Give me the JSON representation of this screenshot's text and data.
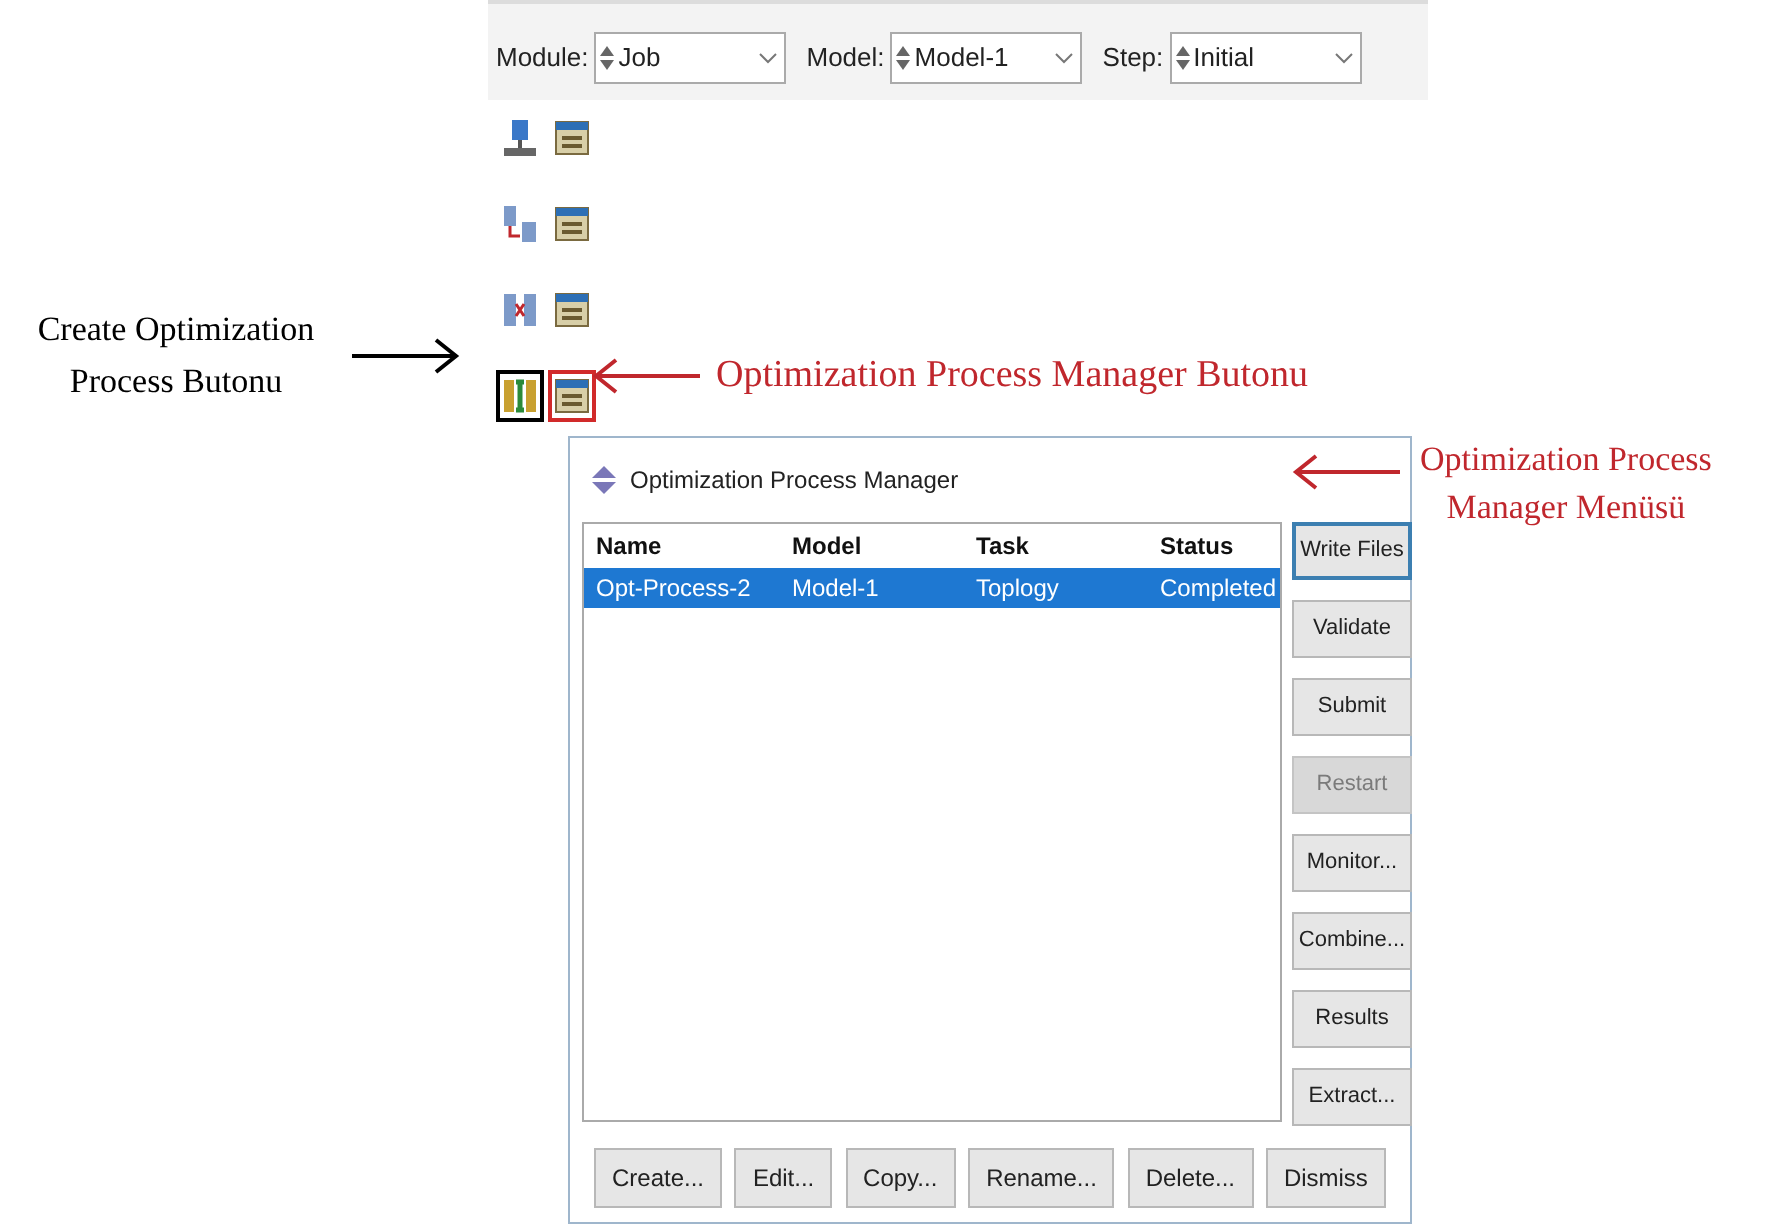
{
  "context_bar": [
    {
      "label": "Module:",
      "value": "Job"
    },
    {
      "label": "Model:",
      "value": "Model-1"
    },
    {
      "label": "Step:",
      "value": "Initial"
    }
  ],
  "toolbox": [
    {
      "kind": "job",
      "left_framed": false,
      "right_framed": false
    },
    {
      "kind": "adaptivity",
      "left_framed": false,
      "right_framed": false
    },
    {
      "kind": "co-execution",
      "left_framed": false,
      "right_framed": false
    },
    {
      "kind": "optimization",
      "left_framed": true,
      "right_framed": true
    }
  ],
  "dialog": {
    "title": "Optimization Process Manager",
    "table": {
      "columns": [
        "Name",
        "Model",
        "Task",
        "Status"
      ],
      "rows": [
        {
          "cells": [
            "Opt-Process-2",
            "Model-1",
            "Toplogy",
            "Completed"
          ],
          "selected": true
        }
      ]
    },
    "side_buttons": [
      {
        "label": "Write Files",
        "disabled": false,
        "focused": true
      },
      {
        "label": "Validate",
        "disabled": false,
        "focused": false
      },
      {
        "label": "Submit",
        "disabled": false,
        "focused": false
      },
      {
        "label": "Restart",
        "disabled": true,
        "focused": false
      },
      {
        "label": "Monitor...",
        "disabled": false,
        "focused": false
      },
      {
        "label": "Combine...",
        "disabled": false,
        "focused": false
      },
      {
        "label": "Results",
        "disabled": false,
        "focused": false
      },
      {
        "label": "Extract...",
        "disabled": false,
        "focused": false
      }
    ],
    "bottom_buttons": [
      "Create...",
      "Edit...",
      "Copy...",
      "Rename...",
      "Delete...",
      "Dismiss"
    ]
  },
  "annotations": [
    {
      "kind": "left",
      "lines": [
        "Create Optimization",
        "Process Butonu"
      ],
      "color": "#000000"
    },
    {
      "kind": "toolbox",
      "lines": [
        "Optimization Process Manager Butonu"
      ],
      "color": "#c0272d"
    },
    {
      "kind": "dialog",
      "lines": [
        "Optimization Process",
        "Manager Menüsü"
      ],
      "color": "#c0272d"
    }
  ]
}
